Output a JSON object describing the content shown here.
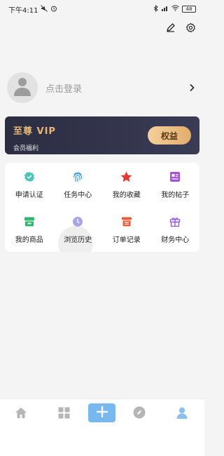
{
  "status_bar": {
    "time": "下午4:11",
    "battery": "48"
  },
  "header_icons": {
    "edit_icon": "pencil-icon",
    "settings_icon": "gear-icon"
  },
  "profile": {
    "login_prompt": "点击登录",
    "avatar_icon": "person-icon"
  },
  "vip": {
    "title": "至尊 VIP",
    "subtitle": "会员福利",
    "button_label": "权益",
    "accent_color": "#e7b774"
  },
  "menu": {
    "items": [
      {
        "label": "申请认证",
        "icon": "shield-check-icon",
        "color": "#4cc3b6"
      },
      {
        "label": "任务中心",
        "icon": "fingerprint-icon",
        "color": "#3a9de0"
      },
      {
        "label": "我的收藏",
        "icon": "star-icon",
        "color": "#e33a33"
      },
      {
        "label": "我的帖子",
        "icon": "post-card-icon",
        "color": "#a552d9"
      },
      {
        "label": "我的商品",
        "icon": "store-icon",
        "color": "#30b56c"
      },
      {
        "label": "浏览历史",
        "icon": "clock-icon",
        "color": "#a7a5e6"
      },
      {
        "label": "订单记录",
        "icon": "receipt-icon",
        "color": "#ef5a33"
      },
      {
        "label": "财务中心",
        "icon": "gift-icon",
        "color": "#8e56d8"
      }
    ]
  },
  "bottom_nav": {
    "items": [
      "home-icon",
      "grid-icon",
      "plus-icon",
      "compass-icon",
      "profile-icon"
    ],
    "active_color": "#8ac0f0",
    "inactive_color": "#b5b5b5"
  }
}
